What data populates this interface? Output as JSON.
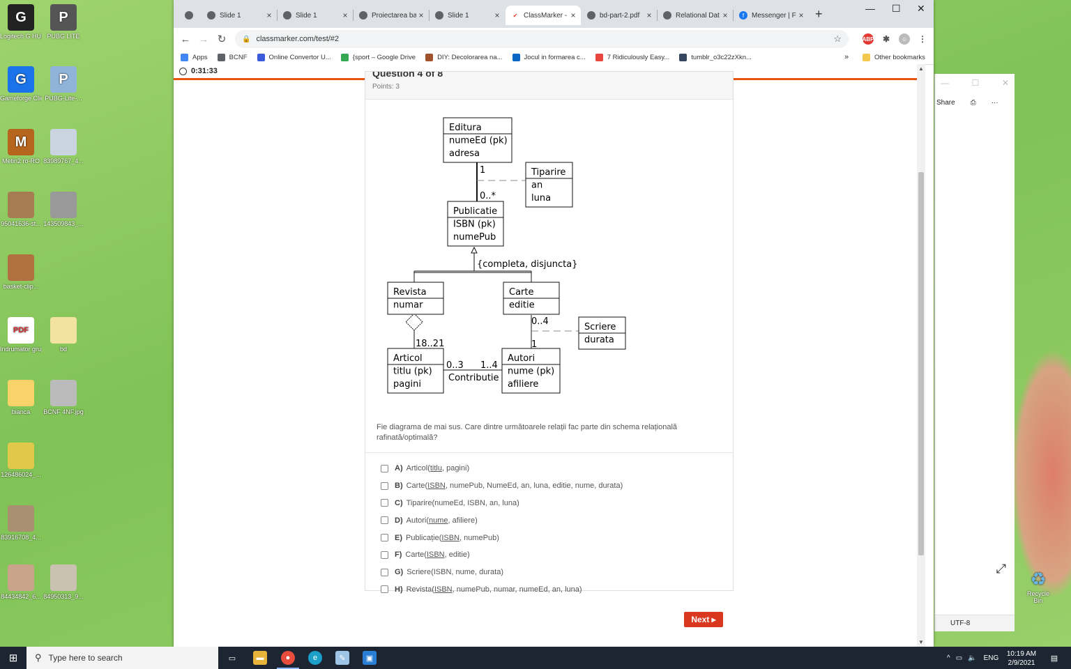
{
  "desktop": {
    "icons": [
      {
        "label": "Logitech G HUB",
        "glyph": "G"
      },
      {
        "label": "PUBG LITE",
        "glyph": "P"
      },
      {
        "label": "Gameforge Client",
        "glyph": "G"
      },
      {
        "label": "PUBG-Lite-...",
        "glyph": "P"
      },
      {
        "label": "Metin2 ro-RO",
        "glyph": "M"
      },
      {
        "label": "83989767_4...",
        "glyph": ""
      },
      {
        "label": "95041636-st...",
        "glyph": ""
      },
      {
        "label": "143509843_...",
        "glyph": ""
      },
      {
        "label": "basket-clip...",
        "glyph": ""
      },
      {
        "label": "Indrumator grupa mi...",
        "glyph": "PDF"
      },
      {
        "label": "bd",
        "glyph": ""
      },
      {
        "label": "bianca",
        "glyph": ""
      },
      {
        "label": "BCNF 4NF.jpg",
        "glyph": ""
      },
      {
        "label": "126486024_...",
        "glyph": ""
      },
      {
        "label": "83916708_4...",
        "glyph": ""
      },
      {
        "label": "84434842_6...",
        "glyph": ""
      },
      {
        "label": "84950313_9...",
        "glyph": ""
      }
    ],
    "recycle_bin": "Recycle Bin"
  },
  "bg_window": {
    "share": "Share",
    "encoding": "UTF-8"
  },
  "browser": {
    "tabs": [
      {
        "label": "",
        "icon": "globe"
      },
      {
        "label": "Slide 1",
        "icon": "globe"
      },
      {
        "label": "Slide 1",
        "icon": "globe"
      },
      {
        "label": "Proiectarea ba",
        "icon": "globe"
      },
      {
        "label": "Slide 1",
        "icon": "globe"
      },
      {
        "label": "ClassMarker -",
        "icon": "classmarker",
        "active": true
      },
      {
        "label": "bd-part-2.pdf",
        "icon": "globe"
      },
      {
        "label": "Relational Dat",
        "icon": "globe"
      },
      {
        "label": "Messenger | F",
        "icon": "facebook"
      }
    ],
    "url": "classmarker.com/test/#2",
    "bookmarks": [
      {
        "label": "Apps",
        "color": "#4285f4"
      },
      {
        "label": "BCNF",
        "color": "#5f6368"
      },
      {
        "label": "Online Convertor U...",
        "color": "#3b5bdb"
      },
      {
        "label": "{sport – Google Drive",
        "color": "#34a853"
      },
      {
        "label": "DIY: Decolorarea na...",
        "color": "#a0522d"
      },
      {
        "label": "Jocul in formarea c...",
        "color": "#0a66c2"
      },
      {
        "label": "7 Ridiculously Easy...",
        "color": "#e8453c"
      },
      {
        "label": "tumblr_o3c22zXkn...",
        "color": "#36465d"
      }
    ],
    "other_bookmarks": "Other bookmarks"
  },
  "quiz": {
    "timer": "0:31:33",
    "question_title": "Question 4 of 8",
    "points": "Points: 3",
    "question_text": "Fie diagrama de mai sus. Care dintre următoarele relații fac parte din schema relațională rafinată/optimală?",
    "options": [
      {
        "letter": "A)",
        "before": "Articol(",
        "key": "titlu",
        "after": ", pagini)"
      },
      {
        "letter": "B)",
        "before": "Carte(",
        "key": "ISBN",
        "after": ", numePub, NumeEd, an, luna, editie, nume, durata)"
      },
      {
        "letter": "C)",
        "before": "Tiparire(numeEd, ISBN, an, luna)",
        "key": "",
        "after": ""
      },
      {
        "letter": "D)",
        "before": "Autori(",
        "key": "nume",
        "after": ", afiliere)"
      },
      {
        "letter": "E)",
        "before": "Publicație(",
        "key": "ISBN",
        "after": ", numePub)"
      },
      {
        "letter": "F)",
        "before": "Carte(",
        "key": "ISBN",
        "after": ", editie)"
      },
      {
        "letter": "G)",
        "before": "Scriere(ISBN, nume, durata)",
        "key": "",
        "after": ""
      },
      {
        "letter": "H)",
        "before": "Revista(",
        "key": "ISBN",
        "after": ", numePub, numar, numeEd, an, luna)"
      }
    ],
    "next_label": "Next"
  },
  "diagram": {
    "classes": {
      "editura": [
        "Editura",
        "numeEd (pk)",
        "adresa"
      ],
      "tiparire": [
        "Tiparire",
        "an",
        "luna"
      ],
      "publicatie": [
        "Publicatie",
        "ISBN (pk)",
        "numePub"
      ],
      "revista": [
        "Revista",
        "numar"
      ],
      "carte": [
        "Carte",
        "editie"
      ],
      "scriere": [
        "Scriere",
        "durata"
      ],
      "articol": [
        "Articol",
        "titlu (pk)",
        "pagini"
      ],
      "autori": [
        "Autori",
        "nume (pk)",
        "afiliere"
      ]
    },
    "labels": {
      "ed_pub_top": "1",
      "ed_pub_bottom": "0..*",
      "constraint": "{completa, disjuncta}",
      "rev_art": "18..21",
      "carte_autori_top": "0..4",
      "carte_autori_bottom": "1",
      "art_side": "0..3",
      "aut_side": "1..4",
      "assoc": "Contributie"
    }
  },
  "taskbar": {
    "search_placeholder": "Type here to search",
    "language": "ENG",
    "time": "10:19 AM",
    "date": "2/9/2021"
  }
}
